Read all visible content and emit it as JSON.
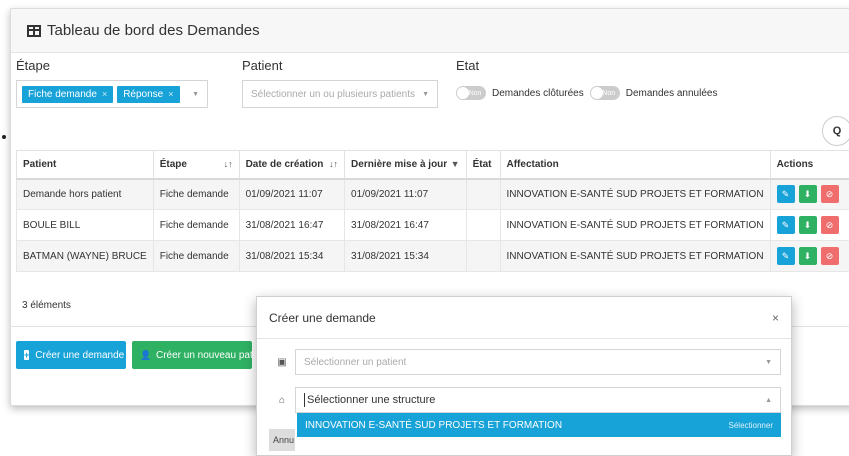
{
  "header": {
    "title": "Tableau de bord des Demandes"
  },
  "filters": {
    "etape": {
      "label": "Étape",
      "tags": [
        "Fiche demande",
        "Réponse"
      ]
    },
    "patient": {
      "label": "Patient",
      "placeholder": "Sélectionner un ou plusieurs patients"
    },
    "etat": {
      "label": "Etat",
      "toggle1": "Non",
      "toggle1_text": "Demandes clôturées",
      "toggle2": "Non",
      "toggle2_text": "Demandes annulées"
    }
  },
  "search": {
    "icon": "search-icon",
    "glyph": "Q"
  },
  "table": {
    "columns": [
      "Patient",
      "Étape",
      "Date de création",
      "Dernière mise à jour",
      "État",
      "Affectation",
      "Actions"
    ],
    "rows": [
      {
        "patient": "Demande hors patient",
        "etape": "Fiche demande",
        "created": "01/09/2021 11:07",
        "updated": "01/09/2021 11:07",
        "etat": "",
        "affectation": "INNOVATION E-SANTÉ SUD PROJETS ET FORMATION"
      },
      {
        "patient": "BOULE BILL",
        "etape": "Fiche demande",
        "created": "31/08/2021 16:47",
        "updated": "31/08/2021 16:47",
        "etat": "",
        "affectation": "INNOVATION E-SANTÉ SUD PROJETS ET FORMATION"
      },
      {
        "patient": "BATMAN (WAYNE) BRUCE",
        "etape": "Fiche demande",
        "created": "31/08/2021 15:34",
        "updated": "31/08/2021 15:34",
        "etat": "",
        "affectation": "INNOVATION E-SANTÉ SUD PROJETS ET FORMATION"
      }
    ]
  },
  "count": "3 éléments",
  "buttons": {
    "create": "Créer une demande",
    "new_patient": "Créer un nouveau pati"
  },
  "modal": {
    "title": "Créer une demande",
    "close": "×",
    "patient_placeholder": "Sélectionner un patient",
    "structure_value": "Sélectionner une structure",
    "option": "INNOVATION E-SANTÉ SUD PROJETS ET FORMATION",
    "option_hint": "Sélectionner",
    "cancel": "Annu"
  },
  "colors": {
    "accent": "#17a2d8",
    "success": "#2fb163",
    "danger": "#ef6d6d"
  }
}
